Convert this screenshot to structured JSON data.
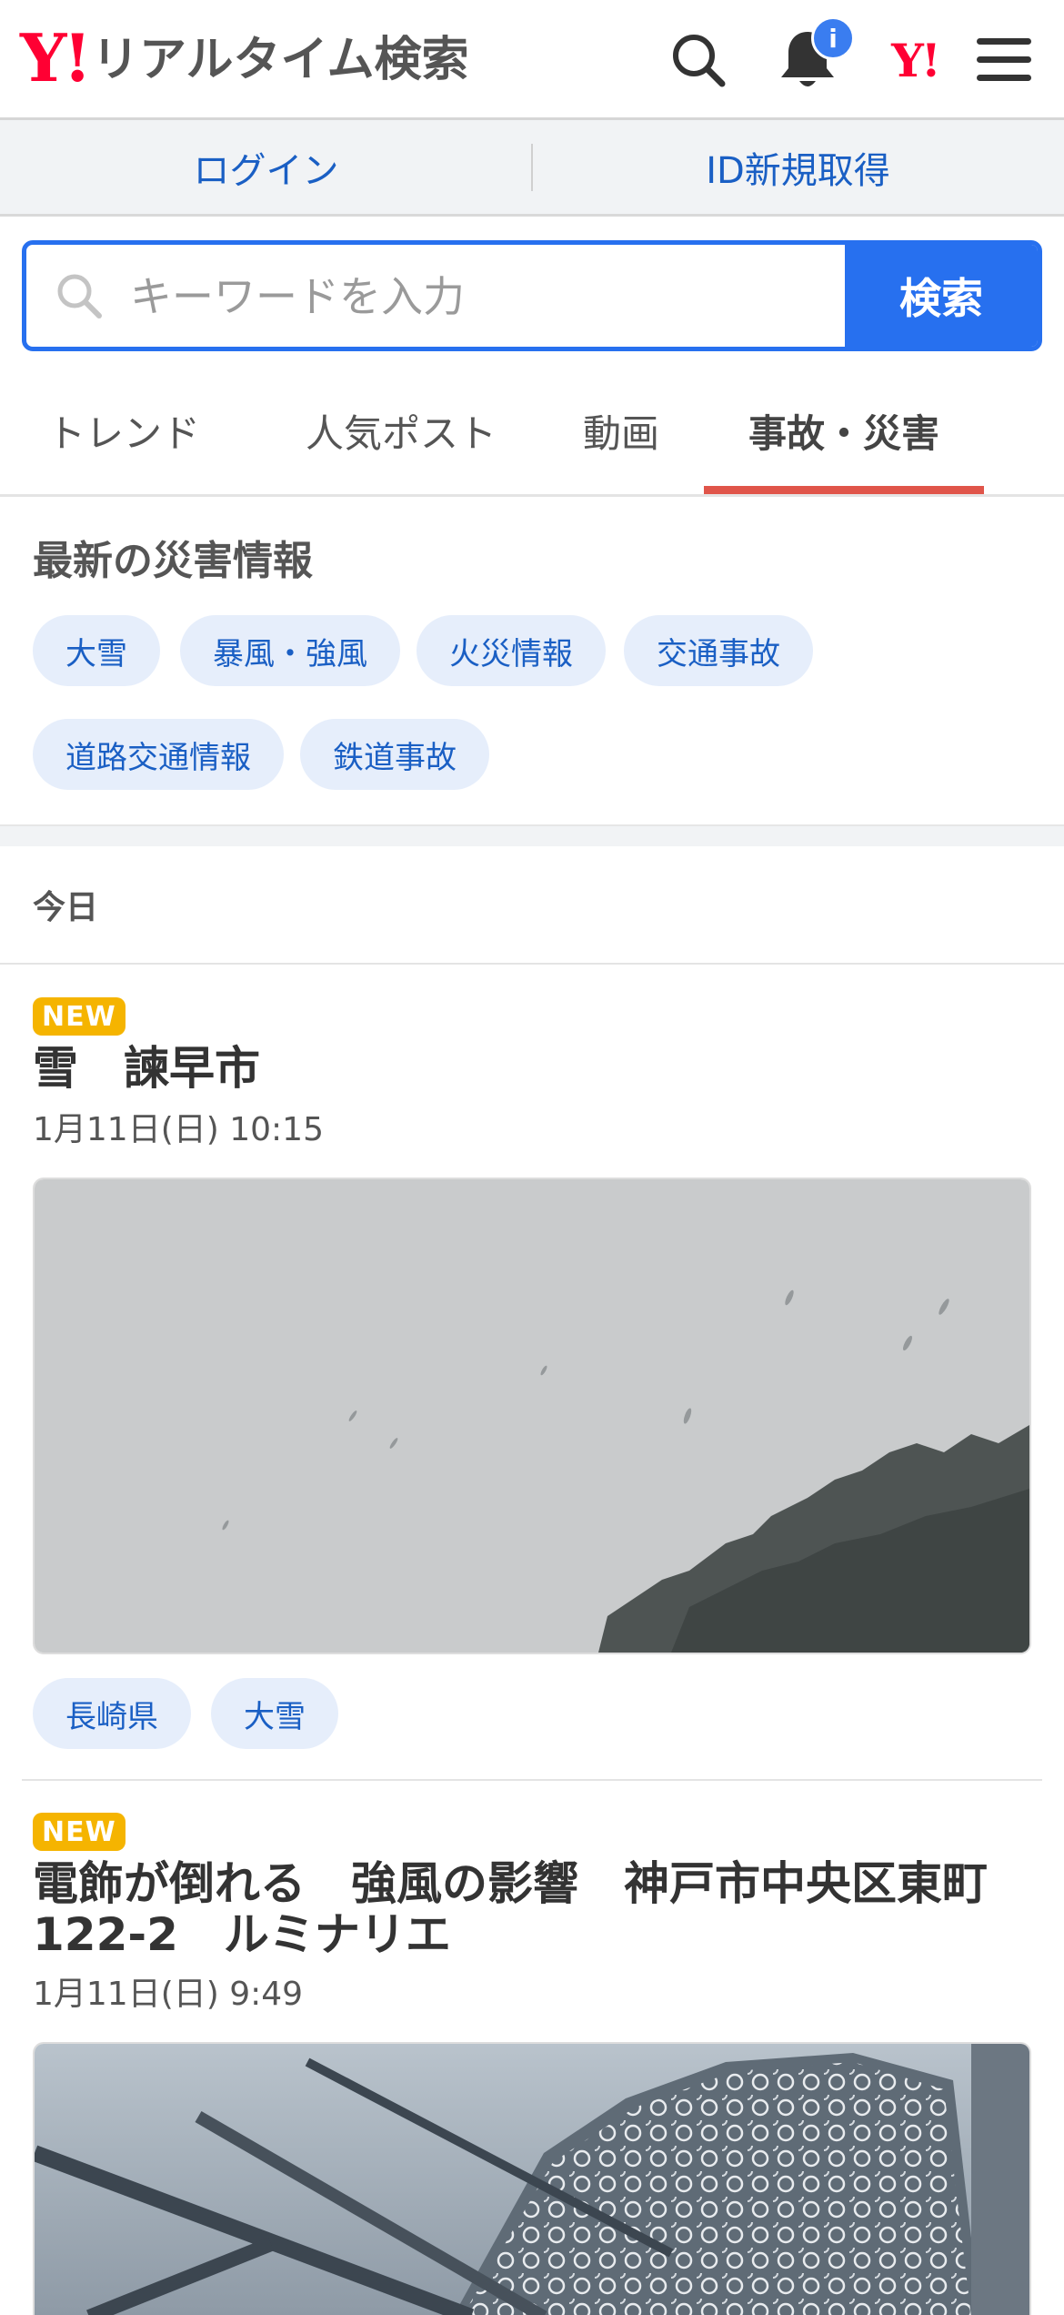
{
  "header": {
    "logo_mark": "Y!",
    "logo_text": "リアルタイム検索",
    "notification_badge": "i",
    "yahoo_mark": "Y!",
    "icons": [
      "search-icon",
      "bell-icon",
      "yahoo-logo-icon",
      "menu-icon"
    ]
  },
  "login_bar": {
    "login_label": "ログイン",
    "register_label": "ID新規取得"
  },
  "search": {
    "placeholder": "キーワードを入力",
    "value": "",
    "button_label": "検索"
  },
  "tabs": [
    {
      "label": "トレンド",
      "active": false
    },
    {
      "label": "人気ポスト",
      "active": false
    },
    {
      "label": "動画",
      "active": false
    },
    {
      "label": "事故・災害",
      "active": true
    }
  ],
  "disaster_section": {
    "title": "最新の災害情報",
    "chips": [
      "大雪",
      "暴風・強風",
      "火災情報",
      "交通事故",
      "道路交通情報",
      "鉄道事故"
    ]
  },
  "date_heading": "今日",
  "articles": [
    {
      "badge": "NEW",
      "title": "雪　諫早市",
      "time": "1月11日(日) 10:15",
      "tags": [
        "長崎県",
        "大雪"
      ]
    },
    {
      "badge": "NEW",
      "title": "電飾が倒れる　強風の影響　神戸市中央区東町122-2　ルミナリエ",
      "time": "1月11日(日) 9:49",
      "tags": []
    }
  ],
  "colors": {
    "brand_red": "#ff0033",
    "accent_blue": "#2770ef",
    "link_blue": "#1a5fc4",
    "chip_bg": "#e6eefb",
    "tab_active_underline": "#e0554a",
    "new_badge": "#f5b400"
  }
}
